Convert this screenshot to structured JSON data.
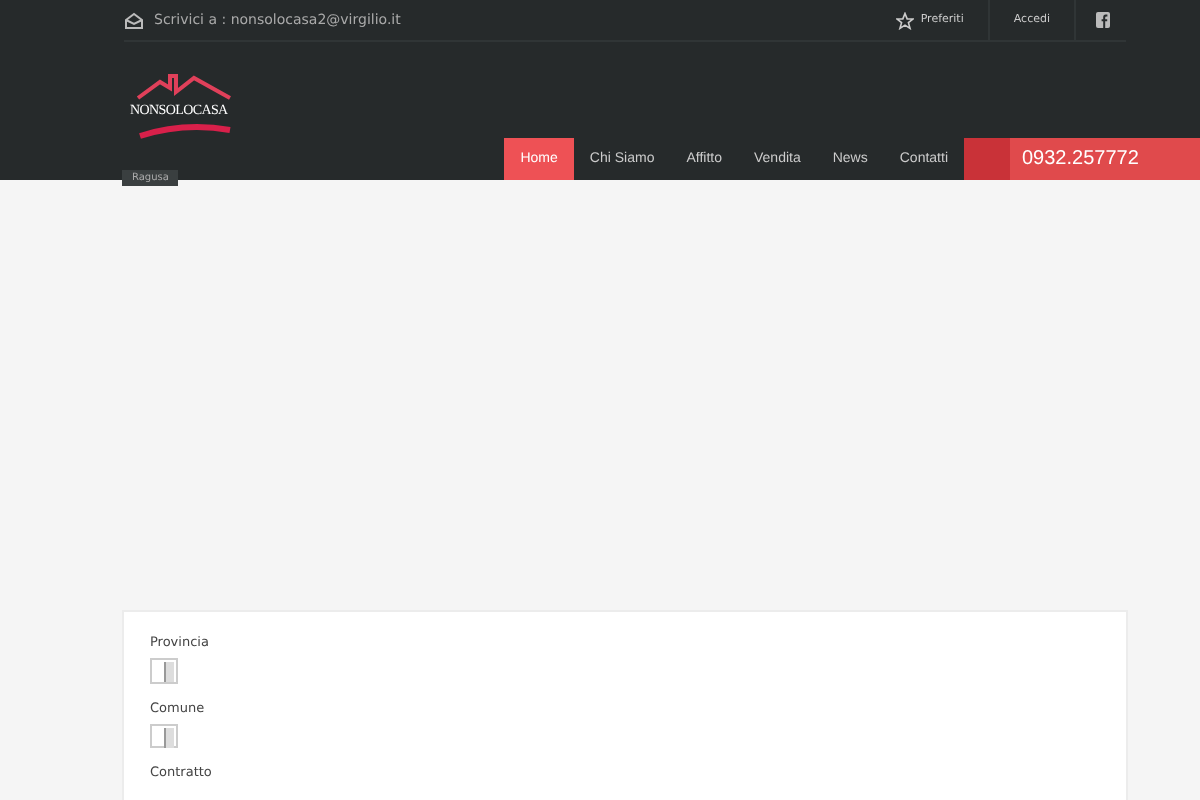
{
  "topbar": {
    "email": "Scrivici a : nonsolocasa2@virgilio.it",
    "links": [
      {
        "label": "Preferiti",
        "kind": "star"
      },
      {
        "label": "Accedi",
        "kind": "plain"
      }
    ]
  },
  "logo": {
    "text": "NONSOLOCASA",
    "city": "Ragusa"
  },
  "nav": [
    {
      "label": "Home",
      "selected": true
    },
    {
      "label": "Chi Siamo",
      "selected": false
    },
    {
      "label": "Affitto",
      "selected": false
    },
    {
      "label": "Vendita",
      "selected": false
    },
    {
      "label": "News",
      "selected": false
    },
    {
      "label": "Contatti",
      "selected": false
    }
  ],
  "phone": "0932.257772",
  "form": {
    "fields": [
      {
        "label": "Provincia",
        "kind": "select"
      },
      {
        "label": "Comune",
        "kind": "select"
      },
      {
        "label": "Contratto",
        "kind": "label"
      }
    ]
  }
}
